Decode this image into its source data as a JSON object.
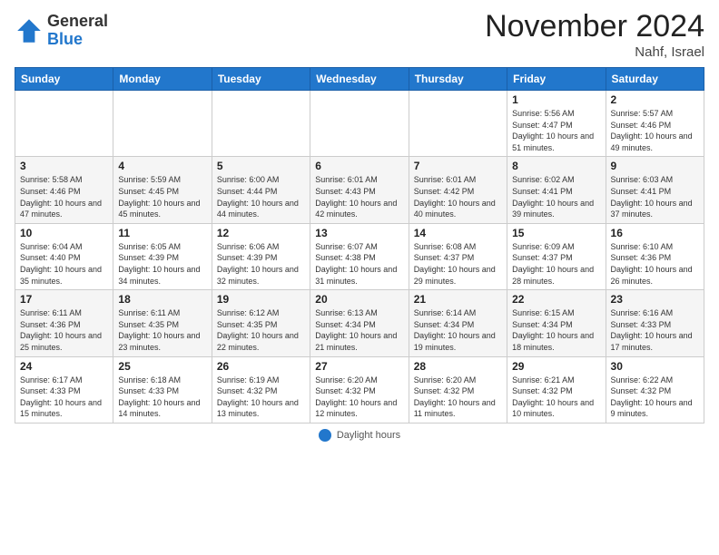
{
  "logo": {
    "line1": "General",
    "line2": "Blue"
  },
  "title": "November 2024",
  "subtitle": "Nahf, Israel",
  "days_header": [
    "Sunday",
    "Monday",
    "Tuesday",
    "Wednesday",
    "Thursday",
    "Friday",
    "Saturday"
  ],
  "footer_label": "Daylight hours",
  "weeks": [
    [
      {
        "day": "",
        "info": ""
      },
      {
        "day": "",
        "info": ""
      },
      {
        "day": "",
        "info": ""
      },
      {
        "day": "",
        "info": ""
      },
      {
        "day": "",
        "info": ""
      },
      {
        "day": "1",
        "info": "Sunrise: 5:56 AM\nSunset: 4:47 PM\nDaylight: 10 hours and 51 minutes."
      },
      {
        "day": "2",
        "info": "Sunrise: 5:57 AM\nSunset: 4:46 PM\nDaylight: 10 hours and 49 minutes."
      }
    ],
    [
      {
        "day": "3",
        "info": "Sunrise: 5:58 AM\nSunset: 4:46 PM\nDaylight: 10 hours and 47 minutes."
      },
      {
        "day": "4",
        "info": "Sunrise: 5:59 AM\nSunset: 4:45 PM\nDaylight: 10 hours and 45 minutes."
      },
      {
        "day": "5",
        "info": "Sunrise: 6:00 AM\nSunset: 4:44 PM\nDaylight: 10 hours and 44 minutes."
      },
      {
        "day": "6",
        "info": "Sunrise: 6:01 AM\nSunset: 4:43 PM\nDaylight: 10 hours and 42 minutes."
      },
      {
        "day": "7",
        "info": "Sunrise: 6:01 AM\nSunset: 4:42 PM\nDaylight: 10 hours and 40 minutes."
      },
      {
        "day": "8",
        "info": "Sunrise: 6:02 AM\nSunset: 4:41 PM\nDaylight: 10 hours and 39 minutes."
      },
      {
        "day": "9",
        "info": "Sunrise: 6:03 AM\nSunset: 4:41 PM\nDaylight: 10 hours and 37 minutes."
      }
    ],
    [
      {
        "day": "10",
        "info": "Sunrise: 6:04 AM\nSunset: 4:40 PM\nDaylight: 10 hours and 35 minutes."
      },
      {
        "day": "11",
        "info": "Sunrise: 6:05 AM\nSunset: 4:39 PM\nDaylight: 10 hours and 34 minutes."
      },
      {
        "day": "12",
        "info": "Sunrise: 6:06 AM\nSunset: 4:39 PM\nDaylight: 10 hours and 32 minutes."
      },
      {
        "day": "13",
        "info": "Sunrise: 6:07 AM\nSunset: 4:38 PM\nDaylight: 10 hours and 31 minutes."
      },
      {
        "day": "14",
        "info": "Sunrise: 6:08 AM\nSunset: 4:37 PM\nDaylight: 10 hours and 29 minutes."
      },
      {
        "day": "15",
        "info": "Sunrise: 6:09 AM\nSunset: 4:37 PM\nDaylight: 10 hours and 28 minutes."
      },
      {
        "day": "16",
        "info": "Sunrise: 6:10 AM\nSunset: 4:36 PM\nDaylight: 10 hours and 26 minutes."
      }
    ],
    [
      {
        "day": "17",
        "info": "Sunrise: 6:11 AM\nSunset: 4:36 PM\nDaylight: 10 hours and 25 minutes."
      },
      {
        "day": "18",
        "info": "Sunrise: 6:11 AM\nSunset: 4:35 PM\nDaylight: 10 hours and 23 minutes."
      },
      {
        "day": "19",
        "info": "Sunrise: 6:12 AM\nSunset: 4:35 PM\nDaylight: 10 hours and 22 minutes."
      },
      {
        "day": "20",
        "info": "Sunrise: 6:13 AM\nSunset: 4:34 PM\nDaylight: 10 hours and 21 minutes."
      },
      {
        "day": "21",
        "info": "Sunrise: 6:14 AM\nSunset: 4:34 PM\nDaylight: 10 hours and 19 minutes."
      },
      {
        "day": "22",
        "info": "Sunrise: 6:15 AM\nSunset: 4:34 PM\nDaylight: 10 hours and 18 minutes."
      },
      {
        "day": "23",
        "info": "Sunrise: 6:16 AM\nSunset: 4:33 PM\nDaylight: 10 hours and 17 minutes."
      }
    ],
    [
      {
        "day": "24",
        "info": "Sunrise: 6:17 AM\nSunset: 4:33 PM\nDaylight: 10 hours and 15 minutes."
      },
      {
        "day": "25",
        "info": "Sunrise: 6:18 AM\nSunset: 4:33 PM\nDaylight: 10 hours and 14 minutes."
      },
      {
        "day": "26",
        "info": "Sunrise: 6:19 AM\nSunset: 4:32 PM\nDaylight: 10 hours and 13 minutes."
      },
      {
        "day": "27",
        "info": "Sunrise: 6:20 AM\nSunset: 4:32 PM\nDaylight: 10 hours and 12 minutes."
      },
      {
        "day": "28",
        "info": "Sunrise: 6:20 AM\nSunset: 4:32 PM\nDaylight: 10 hours and 11 minutes."
      },
      {
        "day": "29",
        "info": "Sunrise: 6:21 AM\nSunset: 4:32 PM\nDaylight: 10 hours and 10 minutes."
      },
      {
        "day": "30",
        "info": "Sunrise: 6:22 AM\nSunset: 4:32 PM\nDaylight: 10 hours and 9 minutes."
      }
    ]
  ]
}
